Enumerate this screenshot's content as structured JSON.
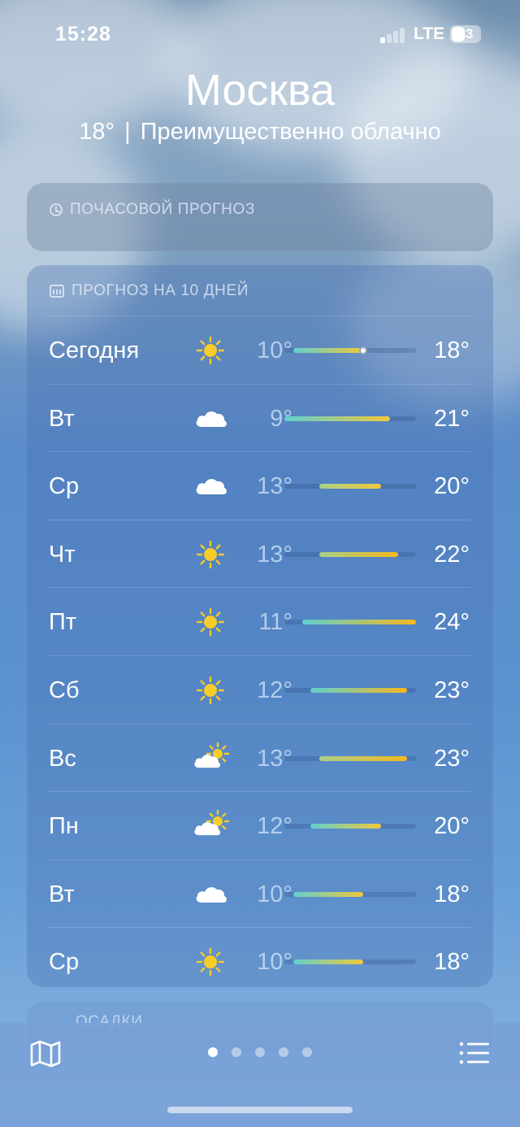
{
  "status_bar": {
    "time": "15:28",
    "network": "LTE",
    "battery": "43"
  },
  "location": {
    "city": "Москва",
    "current_temp": "18°",
    "condition": "Преимущественно облачно"
  },
  "hourly": {
    "title": "ПОЧАСОВОЙ ПРОГНОЗ"
  },
  "forecast": {
    "title": "ПРОГНОЗ НА 10 ДНЕЙ",
    "range_min": 9,
    "range_max": 24,
    "current_temp": 18,
    "days": [
      {
        "day": "Сегодня",
        "icon": "sun-icon",
        "low": "10°",
        "high": "18°",
        "lo": 10,
        "hi": 18,
        "now": true
      },
      {
        "day": "Вт",
        "icon": "cloud-icon",
        "low": "9°",
        "high": "21°",
        "lo": 9,
        "hi": 21
      },
      {
        "day": "Ср",
        "icon": "cloud-icon",
        "low": "13°",
        "high": "20°",
        "lo": 13,
        "hi": 20
      },
      {
        "day": "Чт",
        "icon": "sun-icon",
        "low": "13°",
        "high": "22°",
        "lo": 13,
        "hi": 22
      },
      {
        "day": "Пт",
        "icon": "sun-icon",
        "low": "11°",
        "high": "24°",
        "lo": 11,
        "hi": 24
      },
      {
        "day": "Сб",
        "icon": "sun-icon",
        "low": "12°",
        "high": "23°",
        "lo": 12,
        "hi": 23
      },
      {
        "day": "Вс",
        "icon": "partly-cloudy-icon",
        "low": "13°",
        "high": "23°",
        "lo": 13,
        "hi": 23
      },
      {
        "day": "Пн",
        "icon": "partly-cloudy-icon",
        "low": "12°",
        "high": "20°",
        "lo": 12,
        "hi": 20
      },
      {
        "day": "Вт",
        "icon": "cloud-icon",
        "low": "10°",
        "high": "18°",
        "lo": 10,
        "hi": 18
      },
      {
        "day": "Ср",
        "icon": "sun-icon",
        "low": "10°",
        "high": "18°",
        "lo": 10,
        "hi": 18
      }
    ]
  },
  "next_section": {
    "title": "ОСАДКИ"
  },
  "bottom_bar": {
    "pages": 5,
    "active_page": 0,
    "map_icon": "map-icon",
    "list_icon": "list-icon"
  },
  "colors": {
    "cool": "#5fd0d0",
    "mild": "#a8d08a",
    "warm": "#f0c83a",
    "hot": "#f6b81c"
  }
}
